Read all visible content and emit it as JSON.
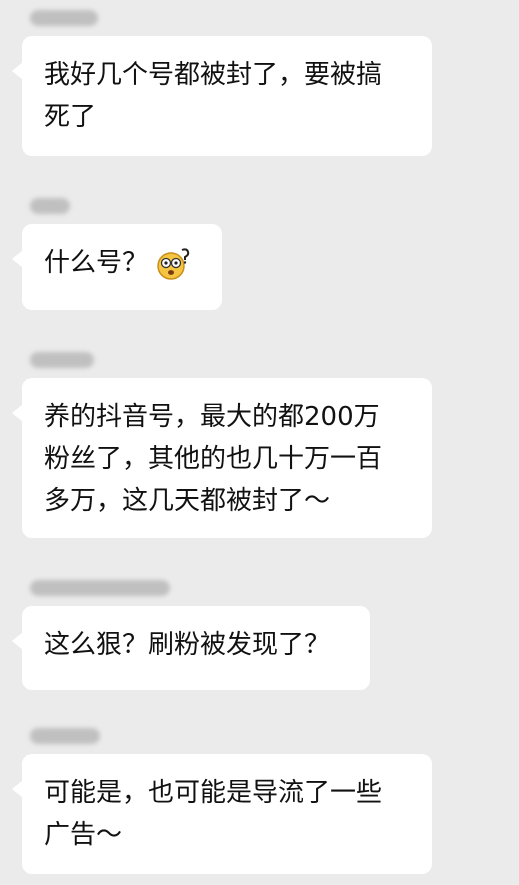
{
  "messages": [
    {
      "sender": "",
      "lines": [
        "我好几个号都被封了，要被搞",
        "死了"
      ]
    },
    {
      "sender": "",
      "lines": [
        "什么号？"
      ],
      "emoji": "confused-face-icon"
    },
    {
      "sender": "",
      "lines": [
        "养的抖音号，最大的都200万",
        "粉丝了，其他的也几十万一百",
        "多万，这几天都被封了～"
      ]
    },
    {
      "sender": "",
      "lines": [
        "这么狠？刷粉被发现了？"
      ]
    },
    {
      "sender": "",
      "lines": [
        "可能是，也可能是导流了一些",
        "广告～"
      ]
    }
  ],
  "colors": {
    "background": "#ebebeb",
    "bubble": "#ffffff",
    "text": "#111111"
  }
}
